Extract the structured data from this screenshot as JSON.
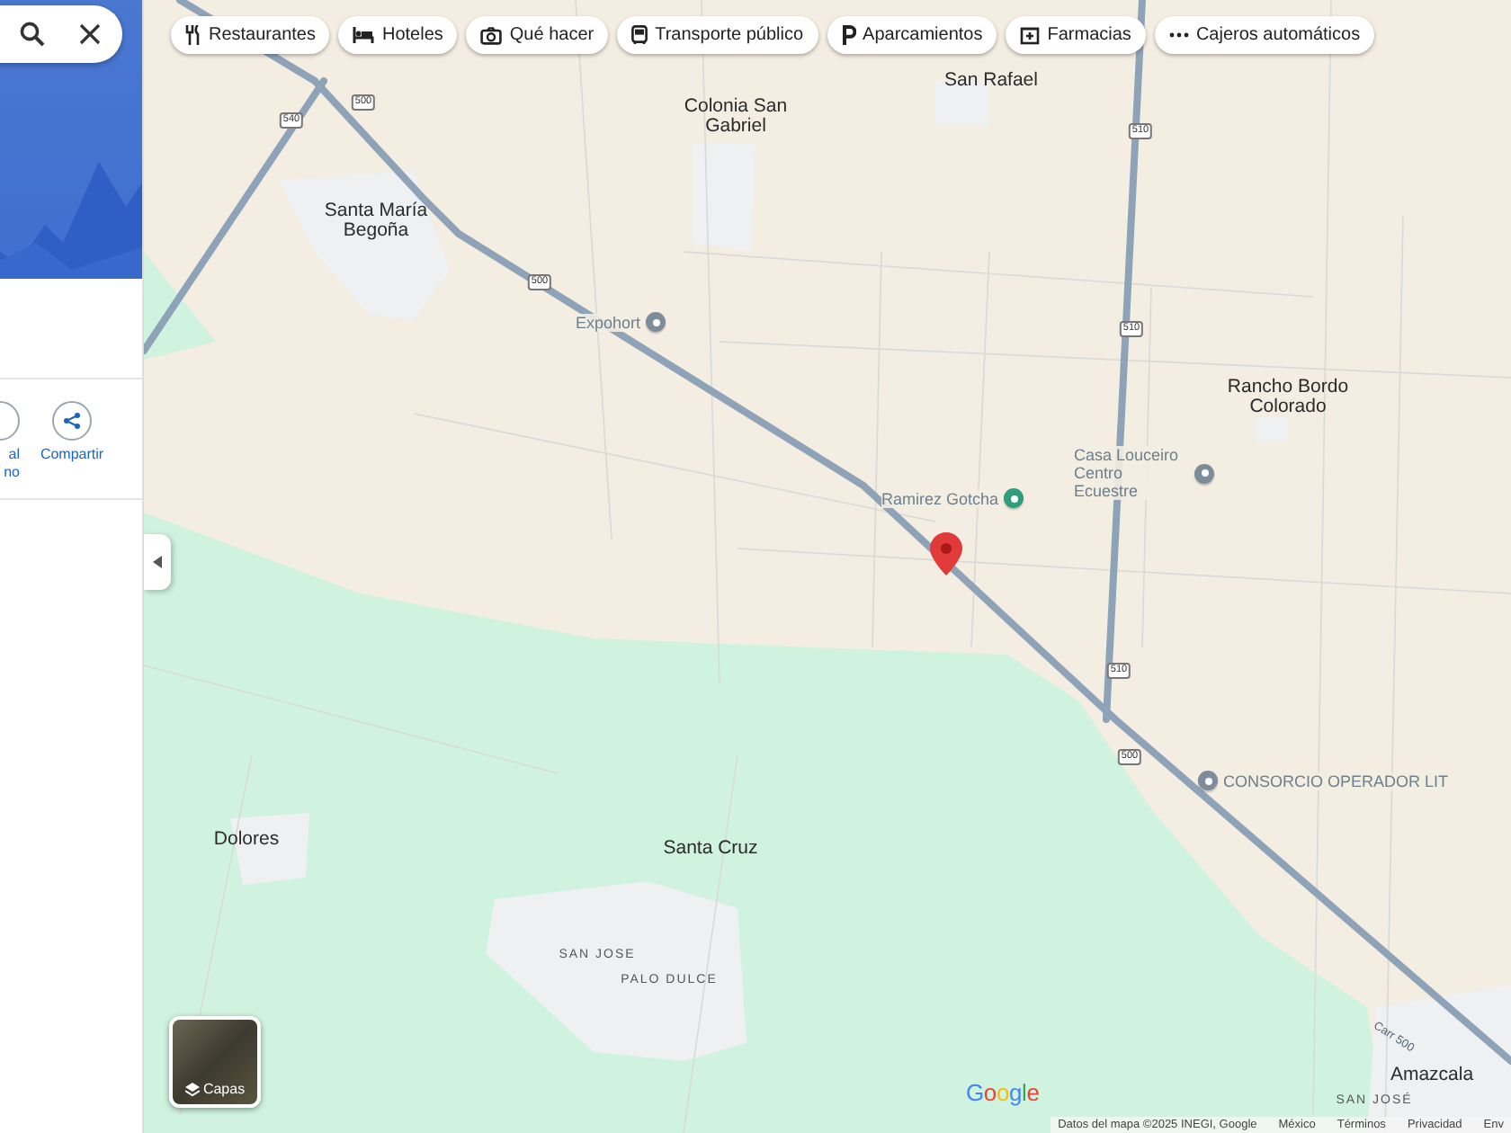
{
  "sidebar": {
    "actions": [
      {
        "label": "al no",
        "kind": "partial"
      },
      {
        "label": "Compartir",
        "kind": "share"
      }
    ]
  },
  "chips": [
    {
      "label": "Restaurantes",
      "kind": "restaurant"
    },
    {
      "label": "Hoteles",
      "kind": "hotel"
    },
    {
      "label": "Qué hacer",
      "kind": "activity"
    },
    {
      "label": "Transporte público",
      "kind": "transit"
    },
    {
      "label": "Aparcamientos",
      "kind": "parking"
    },
    {
      "label": "Farmacias",
      "kind": "pharmacy"
    },
    {
      "label": "Cajeros automáticos",
      "kind": "more"
    }
  ],
  "map": {
    "places": [
      {
        "name": "Colonia San Gabriel",
        "kind": "town"
      },
      {
        "name": "San Rafael",
        "kind": "town"
      },
      {
        "name": "Santa María Begoña",
        "kind": "town"
      },
      {
        "name": "Rancho Bordo Colorado",
        "kind": "town"
      },
      {
        "name": "Dolores",
        "kind": "town"
      },
      {
        "name": "Santa Cruz",
        "kind": "town"
      },
      {
        "name": "SAN JOSE",
        "kind": "neighborhood"
      },
      {
        "name": "PALO DULCE",
        "kind": "neighborhood"
      },
      {
        "name": "Amazcala",
        "kind": "town"
      },
      {
        "name": "SAN JOSÉ",
        "kind": "neighborhood"
      }
    ],
    "pois": [
      {
        "name": "Expohort",
        "color": "#7d8c99"
      },
      {
        "name": "Ramirez Gotcha",
        "color": "#2f9c7b"
      },
      {
        "name": "Casa Louceiro Centro Ecuestre",
        "color": "#7d8c99"
      },
      {
        "name": "CONSORCIO OPERADOR LIT",
        "color": "#7d8c99"
      }
    ],
    "shields": [
      "540",
      "500",
      "500",
      "510",
      "510",
      "510",
      "500"
    ],
    "road_label": "Carr 500",
    "layers_button": {
      "label": "Capas"
    },
    "logo": "Google",
    "attribution": [
      "Datos del mapa ©2025 INEGI, Google",
      "México",
      "Términos",
      "Privacidad",
      "Env"
    ]
  }
}
